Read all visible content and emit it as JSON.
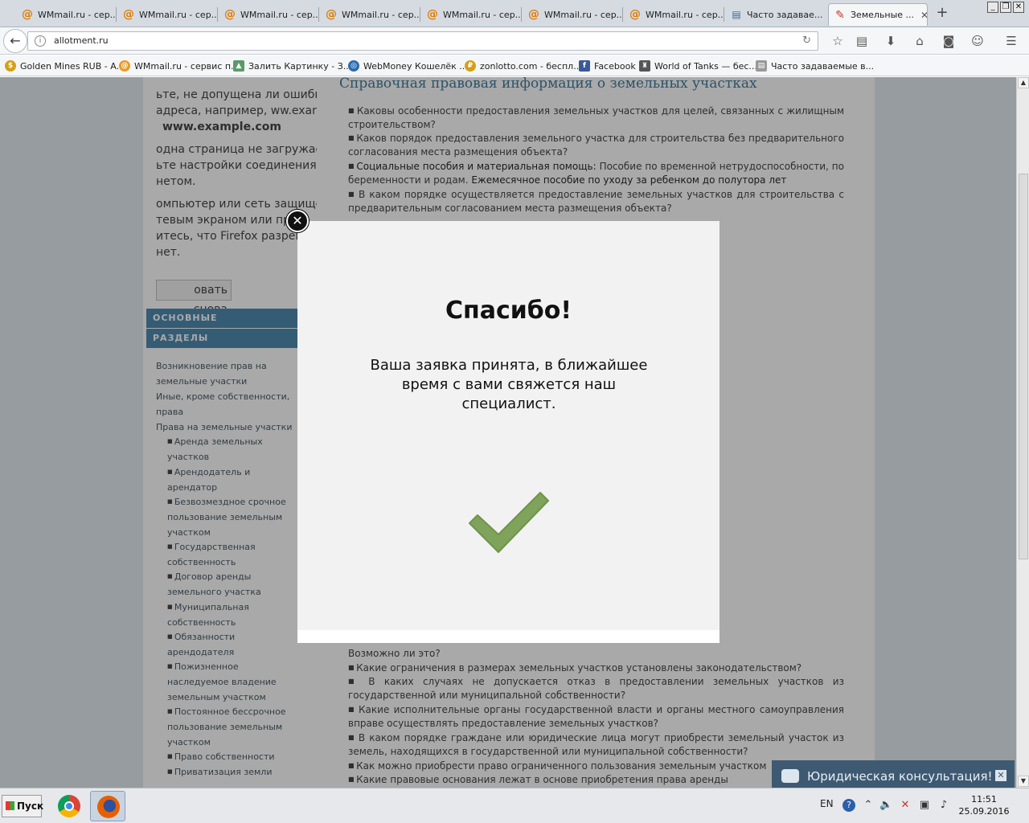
{
  "tabs": [
    {
      "title": "WMmail.ru - сер..."
    },
    {
      "title": "WMmail.ru - сер..."
    },
    {
      "title": "WMmail.ru - сер..."
    },
    {
      "title": "WMmail.ru - сер..."
    },
    {
      "title": "WMmail.ru - сер..."
    },
    {
      "title": "WMmail.ru - сер..."
    },
    {
      "title": "WMmail.ru - сер..."
    },
    {
      "title": "Часто задавае..."
    },
    {
      "title": "Земельные ..."
    }
  ],
  "address": {
    "url": "allotment.ru"
  },
  "bookmarks": [
    {
      "label": "Golden Mines RUB - A..."
    },
    {
      "label": "WMmail.ru - сервис п..."
    },
    {
      "label": "Залить Картинку - З..."
    },
    {
      "label": "WebMoney Кошелёк ..."
    },
    {
      "label": "zonlotto.com - беспл..."
    },
    {
      "label": "Facebook"
    },
    {
      "label": "World of Tanks — бес..."
    },
    {
      "label": "Часто задаваемые в..."
    }
  ],
  "error_page": {
    "lines": [
      "ьте, не допущена ли ошибка",
      "адреса, например, ww.exar",
      "www.example.com",
      "одна страница не загружае",
      "ьте настройки соединения с",
      "нетом.",
      "омпьютер или сеть защище",
      "тевым экраном или пр",
      "итесь, что Firefox разреш",
      "нет."
    ],
    "try_again": "овать снова"
  },
  "sidebar": {
    "heading_1": "ОСНОВНЫЕ",
    "heading_2": "РАЗДЕЛЫ",
    "links": [
      "Возникновение прав на земельные участки",
      "Иные, кроме собственности, права",
      "Права на земельные участки"
    ],
    "sublinks": [
      "Аренда земельных участков",
      "Арендодатель и арендатор",
      "Безвозмездное срочное пользование земельным участком",
      "Государственная собственность",
      "Договор аренды земельного участка",
      "Муниципальная собственность",
      "Обязанности арендодателя",
      "Пожизненное наследуемое владение земельным участком",
      "Постоянное бессрочное пользование земельным участком",
      "Право собственности",
      "Приватизация земли"
    ]
  },
  "content": {
    "title": "Справочная правовая информация о земельных участках",
    "top_items": [
      "Каковы особенности предоставления земельных участков для целей, связанных с жилищным строительством?",
      "Каков порядок предоставления земельного участка для строительства без предварительного согласования места размещения объекта?",
      "В каком порядке осуществляется предоставление земельных участков для строительства с предварительным согласованием места размещения объекта?"
    ],
    "social_label": "Социальные пособия и материальная помощь:",
    "social_text": "Пособие по временной нетрудоспособности, по беременности и родам.",
    "social_link": "Ежемесячное пособие по уходу за ребенком до полутора лет",
    "bottom_items": [
      "Возможно ли это?",
      "Какие ограничения в размерах земельных участков установлены законодательством?",
      "В каких случаях не допускается отказ в предоставлении земельных участков из государственной или муниципальной собственности?",
      "Какие исполнительные органы государственной власти и органы местного самоуправления вправе осуществлять предоставление земельных участков?",
      "В каком порядке граждане или юридические лица могут приобрести земельный участок из земель, находящихся в государственной или муниципальной собственности?",
      "Как можно приобрести право ограниченного пользования земельным участком",
      "Какие правовые основания лежат в основе приобретения права аренды"
    ]
  },
  "modal": {
    "title": "Спасибо!",
    "message": "Ваша заявка принята, в ближайшее время с вами свяжется наш специалист.",
    "check_color": "#7fa35a"
  },
  "chat": {
    "label": "Юридическая консультация!"
  },
  "taskbar": {
    "start": "Пуск",
    "lang": "EN",
    "time": "11:51",
    "date": "25.09.2016"
  }
}
